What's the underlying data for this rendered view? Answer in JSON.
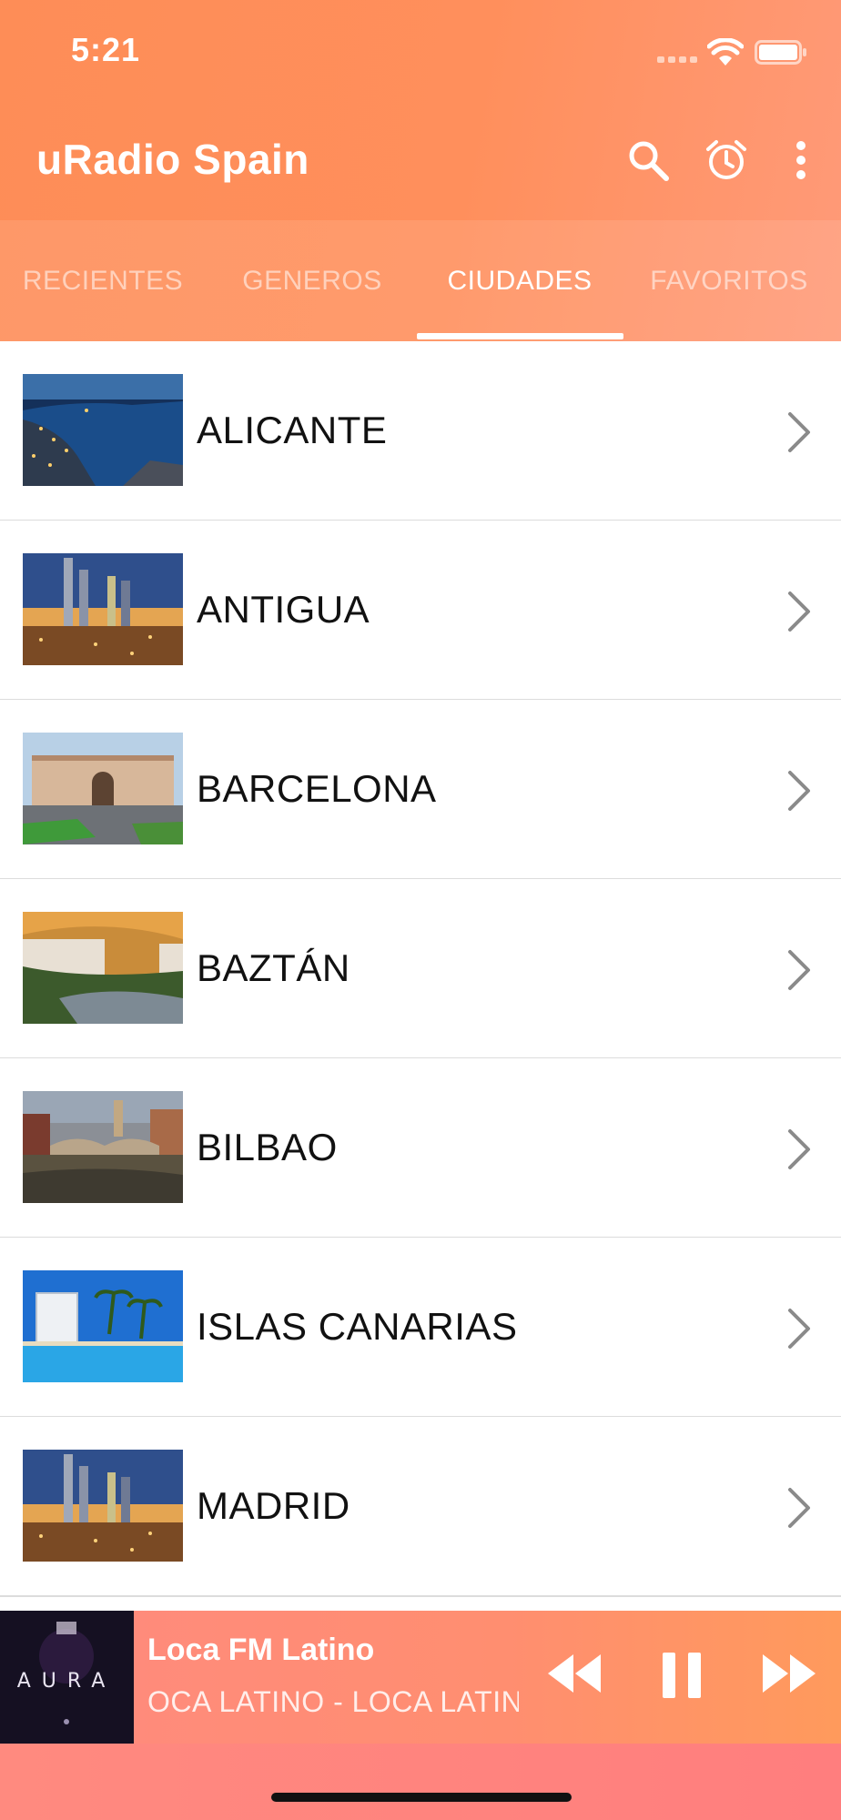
{
  "status_bar": {
    "time": "5:21"
  },
  "app": {
    "title": "uRadio Spain",
    "actions": [
      "search-icon",
      "alarm-clock-icon",
      "more-vert-icon"
    ]
  },
  "tabs": [
    {
      "label": "RECIENTES",
      "active": false
    },
    {
      "label": "GENEROS",
      "active": false
    },
    {
      "label": "CIUDADES",
      "active": true
    },
    {
      "label": "FAVORITOS",
      "active": false
    }
  ],
  "cities": [
    {
      "name": "ALICANTE"
    },
    {
      "name": "ANTIGUA"
    },
    {
      "name": "BARCELONA"
    },
    {
      "name": "BAZTÁN"
    },
    {
      "name": "BILBAO"
    },
    {
      "name": "ISLAS CANARIAS"
    },
    {
      "name": "MADRID"
    }
  ],
  "player": {
    "title": "Loca FM Latino",
    "subtitle": "OCA LATINO - LOCA LATINO",
    "art_text": "AURA",
    "controls": [
      "rewind-icon",
      "pause-icon",
      "fast-forward-icon"
    ]
  },
  "colors": {
    "header_start": "#fe8d57",
    "header_end": "#ff9a78",
    "player_start": "#ff8a7f",
    "player_end": "#ff9a5c"
  }
}
